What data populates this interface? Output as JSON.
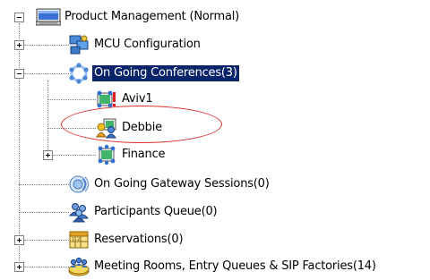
{
  "tree": {
    "root": {
      "label": "Product Management  (Normal)",
      "icon": "monitor-server-icon",
      "expander": "minus"
    },
    "mcu_configuration": {
      "label": "MCU Configuration",
      "icon": "configuration-icon",
      "expander": "plus"
    },
    "ongoing_conferences": {
      "label": "On Going Conferences(3)",
      "icon": "conference-ring-icon",
      "expander": "minus",
      "selected": true
    },
    "conferences": [
      {
        "label": "Aviv1",
        "icon": "conference-alert-icon",
        "expander": null
      },
      {
        "label": "Debbie",
        "icon": "conference-participants-icon",
        "expander": null,
        "annotated": true
      },
      {
        "label": "Finance",
        "icon": "conference-icon",
        "expander": "plus"
      }
    ],
    "gateway_sessions": {
      "label": "On Going Gateway Sessions(0)",
      "icon": "gateway-icon",
      "expander": null
    },
    "participants_queue": {
      "label": "Participants Queue(0)",
      "icon": "participants-queue-icon",
      "expander": null
    },
    "reservations": {
      "label": "Reservations(0)",
      "icon": "calendar-icon",
      "expander": "plus"
    },
    "meeting_rooms": {
      "label": "Meeting Rooms, Entry Queues & SIP Factories(14)",
      "icon": "meeting-rooms-icon",
      "expander": "plus"
    }
  },
  "colors": {
    "selection_background": "#0a246a",
    "annotation_ellipse": "#e03030",
    "tree_lines": "#7f7f7f"
  }
}
